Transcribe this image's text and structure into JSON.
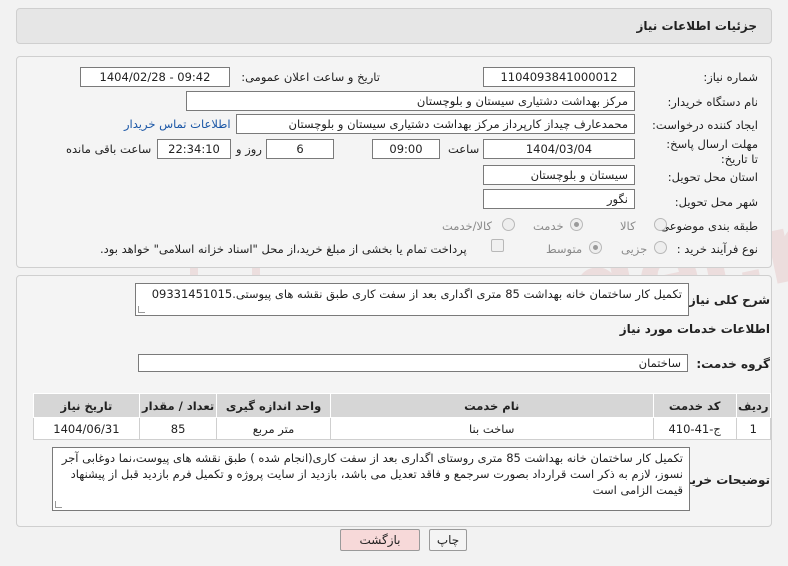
{
  "header": {
    "title": "جزئیات اطلاعات نیاز"
  },
  "form": {
    "need_number_label": "شماره نیاز:",
    "need_number": "1104093841000012",
    "announce_label": "تاریخ و ساعت اعلان عمومی:",
    "announce_value": "1404/02/28 - 09:42",
    "buyer_org_label": "نام دستگاه خریدار:",
    "buyer_org": "مرکز بهداشت دشتیاری سیستان و بلوچستان",
    "creator_label": "ایجاد کننده درخواست:",
    "creator": "محمدعارف چیداز کارپرداز مرکز بهداشت دشتیاری سیستان و بلوچستان",
    "contact_link": "اطلاعات تماس خریدار",
    "deadline_label": "مهلت ارسال پاسخ: تا تاریخ:",
    "deadline_date": "1404/03/04",
    "time_label": "ساعت",
    "deadline_time": "09:00",
    "days_value": "6",
    "days_label": "روز و",
    "remaining_time": "22:34:10",
    "remaining_label": "ساعت باقی مانده",
    "province_label": "استان محل تحویل:",
    "province": "سیستان و بلوچستان",
    "city_label": "شهر محل تحویل:",
    "city": "نگور",
    "category_label": "طبقه بندی موضوعی:",
    "category_options": [
      "کالا",
      "خدمت",
      "کالا/خدمت"
    ],
    "process_label": "نوع فرآیند خرید :",
    "process_options": [
      "جزیی",
      "متوسط"
    ],
    "payment_note": "پرداخت تمام یا بخشی از مبلغ خرید،از محل \"اسناد خزانه اسلامی\" خواهد بود."
  },
  "summary": {
    "label": "شرح کلی نیاز:",
    "text": "تکمیل کار ساختمان خانه بهداشت 85 متری اگداری بعد از سفت کاری طبق نقشه های پیوستی.09331451015"
  },
  "services": {
    "section_title": "اطلاعات خدمات مورد نیاز",
    "group_label": "گروه خدمت:",
    "group_value": "ساختمان",
    "columns": [
      "ردیف",
      "کد خدمت",
      "نام خدمت",
      "واحد اندازه گیری",
      "تعداد / مقدار",
      "تاریخ نیاز"
    ],
    "rows": [
      [
        "1",
        "ج-41-410",
        "ساخت بنا",
        "متر مربع",
        "85",
        "1404/06/31"
      ]
    ]
  },
  "buyer_notes": {
    "label": "توضیحات خریدار:",
    "text": "تکمیل کار ساختمان خانه بهداشت 85 متری روستای اگداری بعد از سفت کاری(انجام شده ) طبق نقشه های پیوست،نما دوغابی آجر نسوز، لازم به ذکر است قرارداد بصورت سرجمع و فاقد تعدیل می باشد، بازدید از سایت پروژه و تکمیل فرم بازدید قبل از پیشنهاد قیمت الزامی است"
  },
  "buttons": {
    "print": "چاپ",
    "back": "بازگشت"
  },
  "watermark": "AriaTender.net",
  "colors": {
    "link": "#1a56a6",
    "back_button": "#f7d9d9",
    "table_header": "#d6d6d6"
  }
}
